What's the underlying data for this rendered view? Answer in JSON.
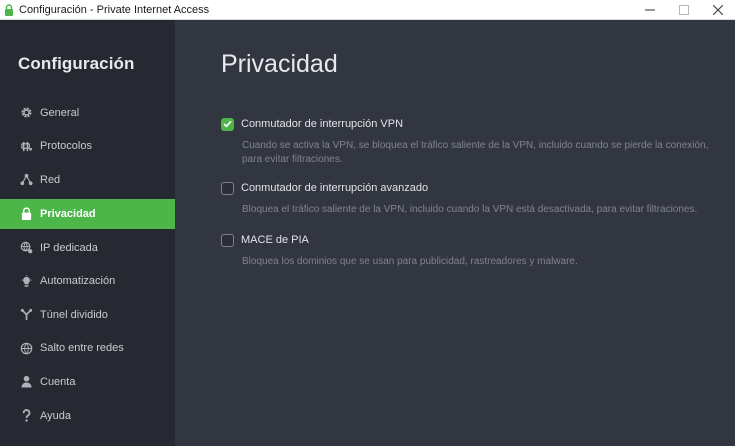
{
  "window": {
    "title": "Configuración - Private Internet Access",
    "controls": [
      "minimize-icon",
      "maximize-icon",
      "close-icon"
    ]
  },
  "sidebar": {
    "title": "Configuración",
    "items": [
      {
        "label": "General",
        "icon": "gear-icon",
        "active": false
      },
      {
        "label": "Protocolos",
        "icon": "protocol-icon",
        "active": false
      },
      {
        "label": "Red",
        "icon": "network-icon",
        "active": false
      },
      {
        "label": "Privacidad",
        "icon": "lock-icon",
        "active": true
      },
      {
        "label": "IP dedicada",
        "icon": "dedicated-ip-icon",
        "active": false
      },
      {
        "label": "Automatización",
        "icon": "lightbulb-icon",
        "active": false
      },
      {
        "label": "Túnel dividido",
        "icon": "split-tunnel-icon",
        "active": false
      },
      {
        "label": "Salto entre redes",
        "icon": "globe-icon",
        "active": false
      },
      {
        "label": "Cuenta",
        "icon": "user-icon",
        "active": false
      },
      {
        "label": "Ayuda",
        "icon": "question-icon",
        "active": false
      }
    ]
  },
  "main": {
    "title": "Privacidad",
    "options": [
      {
        "label": "Conmutador de interrupción VPN",
        "checked": true,
        "description": "Cuando se activa la VPN, se bloquea el tráfico saliente de la VPN, incluido cuando se pierde la conexión, para evitar filtraciones."
      },
      {
        "label": "Conmutador de interrupción avanzado",
        "checked": false,
        "description": "Bloquea el tráfico saliente de la VPN, incluido cuando la VPN está desactivada, para evitar filtraciones."
      },
      {
        "label": "MACE de PIA",
        "checked": false,
        "description": "Bloquea los dominios que se usan para publicidad, rastreadores y malware."
      }
    ]
  },
  "colors": {
    "accent": "#4cb649",
    "sidebar_bg": "#262931",
    "main_bg": "#323640"
  }
}
